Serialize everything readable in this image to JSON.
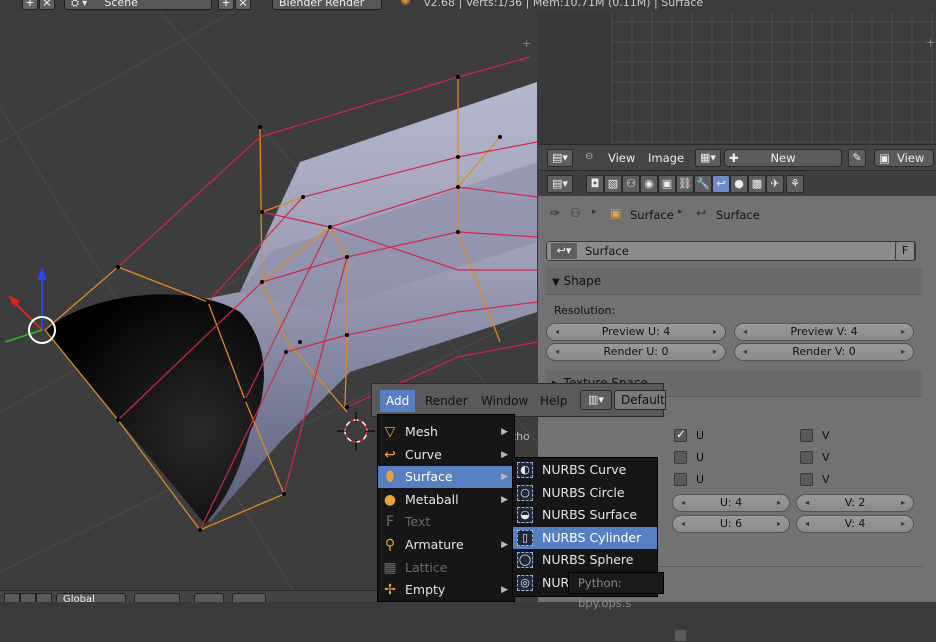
{
  "topbar": {
    "scene_label": "Scene",
    "render_engine": "Blender Render",
    "info": "v2.68 | Verts:1/36 | Mem:10.71M (0.11M) | Surface"
  },
  "viewport": {
    "view_label": "User Ortho",
    "bottom_orientation": "Global"
  },
  "image_editor": {
    "menu_view": "View",
    "menu_image": "Image",
    "new_button": "New",
    "view_dropdown": "View"
  },
  "properties": {
    "breadcrumb": [
      "Surface",
      "Surface"
    ],
    "datablock_name": "Surface",
    "datablock_flag": "F",
    "shape_section": "Shape",
    "resolution_label": "Resolution:",
    "preview_u": "Preview U: 4",
    "preview_v": "Preview V: 4",
    "render_u": "Render U: 0",
    "render_v": "Render V: 0",
    "texture_space_section": "Texture Space",
    "u_label": "U",
    "v_label": "V",
    "order_u": "U: 4",
    "order_v": "V: 2",
    "res_u": "U: 6",
    "res_v": "V: 4"
  },
  "menubar": {
    "add": "Add",
    "render": "Render",
    "window": "Window",
    "help": "Help",
    "layout": "Default"
  },
  "add_menu": [
    {
      "label": "Mesh",
      "icon": "mesh-icon",
      "glyph": "▽",
      "submenu": true,
      "disabled": false
    },
    {
      "label": "Curve",
      "icon": "curve-icon",
      "glyph": "↩",
      "submenu": true,
      "disabled": false
    },
    {
      "label": "Surface",
      "icon": "surface-icon",
      "glyph": "⬮",
      "submenu": true,
      "disabled": false,
      "highlight": true
    },
    {
      "label": "Metaball",
      "icon": "metaball-icon",
      "glyph": "●",
      "submenu": true,
      "disabled": false
    },
    {
      "label": "Text",
      "icon": "text-icon",
      "glyph": "F",
      "submenu": false,
      "disabled": true
    },
    {
      "label": "Armature",
      "icon": "armature-icon",
      "glyph": "⚲",
      "submenu": true,
      "disabled": false
    },
    {
      "label": "Lattice",
      "icon": "lattice-icon",
      "glyph": "▦",
      "submenu": false,
      "disabled": true
    },
    {
      "label": "Empty",
      "icon": "empty-icon",
      "glyph": "✢",
      "submenu": true,
      "disabled": false
    }
  ],
  "surface_submenu": [
    {
      "label": "NURBS Curve",
      "icon": "nurbs-curve-icon",
      "glyph": "◐"
    },
    {
      "label": "NURBS Circle",
      "icon": "nurbs-circle-icon",
      "glyph": "○"
    },
    {
      "label": "NURBS Surface",
      "icon": "nurbs-surface-icon",
      "glyph": "◒"
    },
    {
      "label": "NURBS Cylinder",
      "icon": "nurbs-cylinder-icon",
      "glyph": "▯",
      "highlight": true
    },
    {
      "label": "NURBS Sphere",
      "icon": "nurbs-sphere-icon",
      "glyph": "◯"
    },
    {
      "label": "NURBS Torus",
      "icon": "nurbs-torus-icon",
      "glyph": "◎"
    }
  ],
  "tooltip": "Python: bpy.ops.s"
}
